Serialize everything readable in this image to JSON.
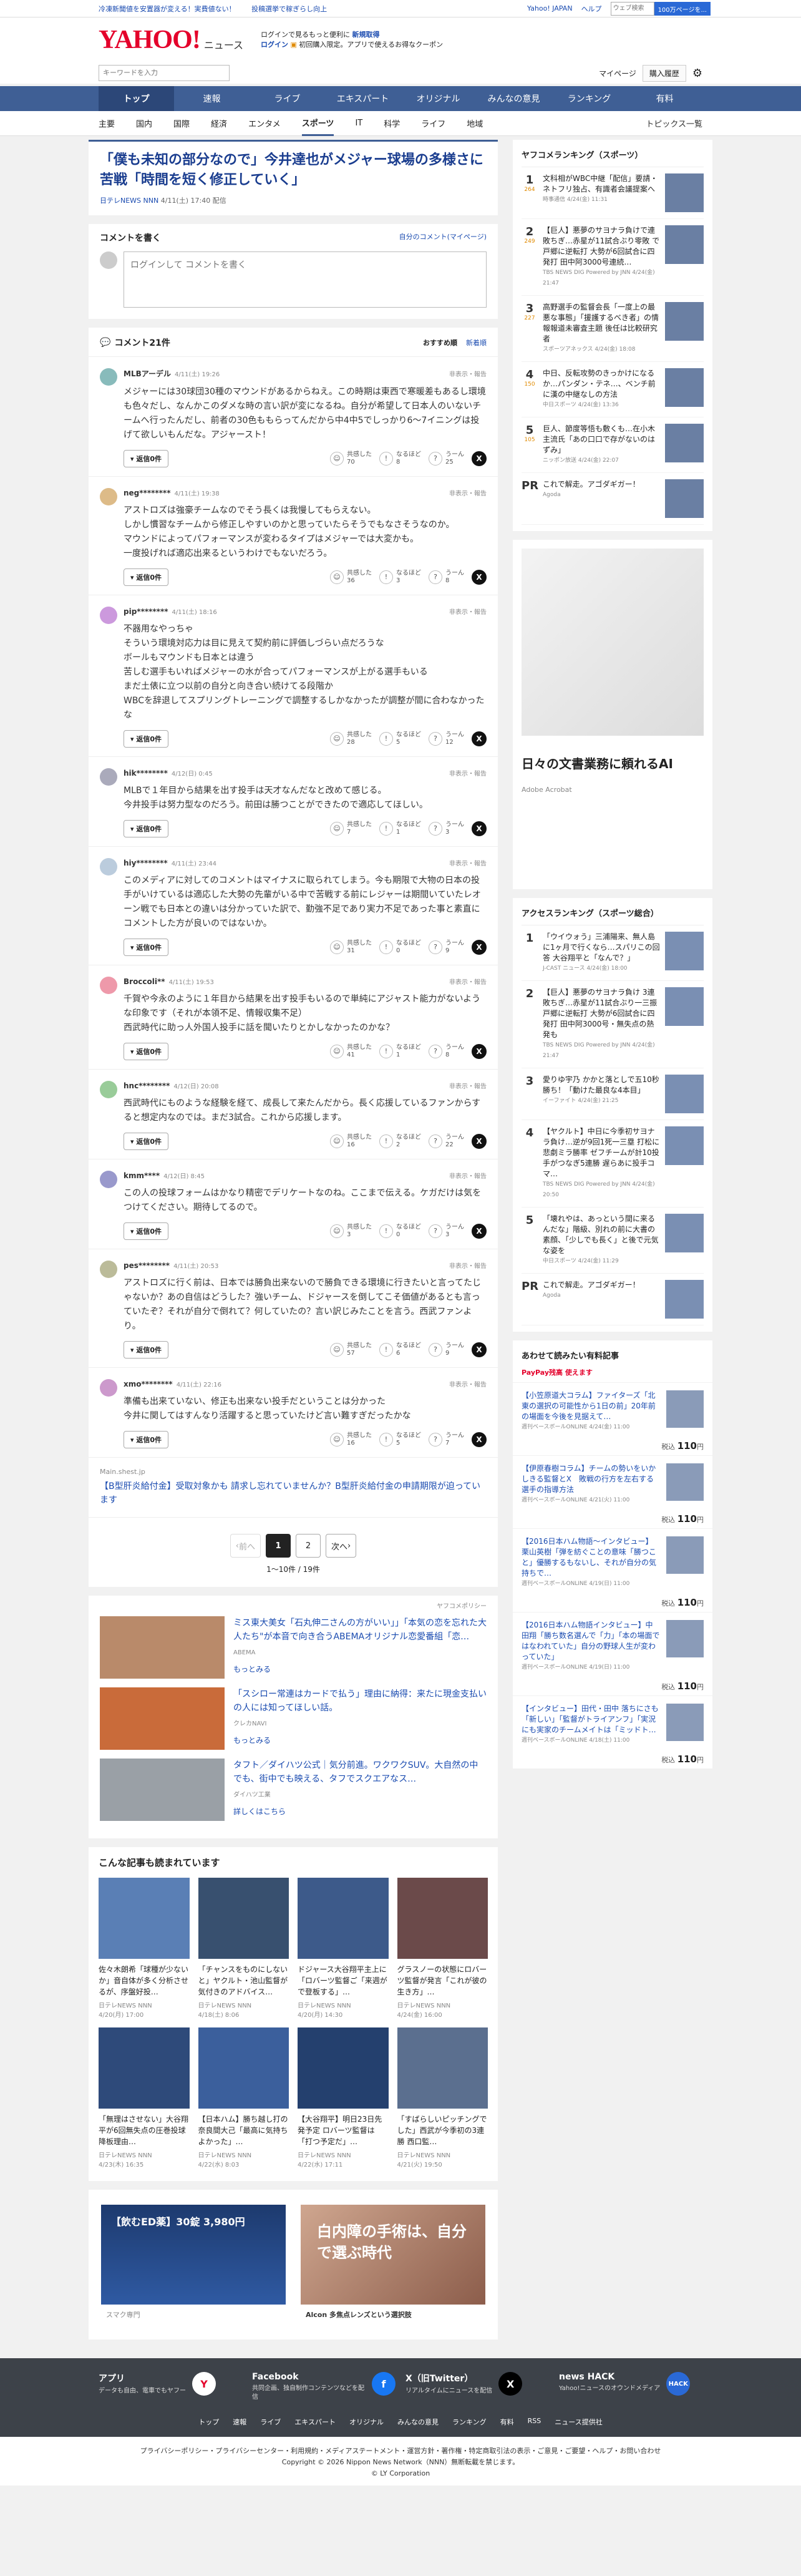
{
  "topbar": {
    "links": [
      "冷凍新聞値を安置器が変える！実費値ない！",
      "投稿選挙で稼ぎらし向上"
    ],
    "right": [
      "Yahoo! JAPAN",
      "ヘルプ"
    ],
    "search_placeholder": "ウェブ検索",
    "search_btn": "100万ページを..."
  },
  "header": {
    "logo": "YAHOO!",
    "logo_sub": "ニュース",
    "promo1": "ログインで見るもっと便利に",
    "promo1b": "新規取得",
    "promo2": "ログイン",
    "promo2b": "初回購入限定。アプリで使えるお得なクーポン"
  },
  "search": {
    "placeholder": "キーワードを入力",
    "mypage": "マイページ",
    "purchase": "購入履歴"
  },
  "mainnav": [
    "トップ",
    "速報",
    "ライブ",
    "エキスパート",
    "オリジナル",
    "みんなの意見",
    "ランキング",
    "有料"
  ],
  "subnav": [
    "主要",
    "国内",
    "国際",
    "経済",
    "エンタメ",
    "スポーツ",
    "IT",
    "科学",
    "ライフ",
    "地域"
  ],
  "subnav_right": "トピックス一覧",
  "article": {
    "title": "「僕も未知の部分なので」今井達也がメジャー球場の多様さに苦戦「時間を短く修正していく」",
    "source": "日テレNEWS NNN",
    "date": "4/11(土) 17:40 配信"
  },
  "write": {
    "title": "コメントを書く",
    "link": "自分のコメント(マイページ)",
    "placeholder": "ログインして コメントを書く"
  },
  "clist": {
    "title": "コメント21件",
    "sort1": "おすすめ順",
    "sort2": "新着順"
  },
  "labels": {
    "report": "非表示・報告",
    "reply": "返信0件",
    "r1": "共感した",
    "r2": "なるほど",
    "r3": "うーん"
  },
  "comments": [
    {
      "user": "MLBアーデル",
      "date": "4/11(土) 19:26",
      "text": "メジャーには30球団30種のマウンドがあるからねえ。この時期は東西で寒暖差もあるし環境も色々だし、なんかこのダメな時の言い訳が変になるね。自分が希望して日本人のいないチームへ行ったんだし、前者の30色ももらってんだから中4中5でしっかり6〜7イニングは投げて欲しいもんだな。アジャースト！",
      "n": [
        70,
        8,
        25
      ]
    },
    {
      "user": "neg********",
      "date": "4/11(土) 19:38",
      "text": "アストロズは強豪チームなのでそう長くは我慢してもらえない。\nしかし慣習なチームから修正しやすいのかと思っていたらそうでもなさそうなのか。\nマウンドによってパフォーマンスが変わるタイプはメジャーでは大変かも。\n一度投げれば適応出来るというわけでもないだろう。",
      "n": [
        36,
        3,
        8
      ]
    },
    {
      "user": "pip********",
      "date": "4/11(土) 18:16",
      "text": "不器用なやっちゃ\nそういう環境対応力は目に見えて契約前に評価しづらい点だろうな\nボールもマウンドも日本とは違う\n苦しむ選手もいればメジャーの水が合ってパフォーマンスが上がる選手もいる\nまだ土俵に立つ以前の自分と向き合い続けてる段階か\nWBCを辞退してスプリングトレーニングで調整するしかなかったが調整が間に合わなかったな",
      "n": [
        28,
        5,
        12
      ]
    },
    {
      "user": "hik********",
      "date": "4/12(日) 0:45",
      "text": "MLBで１年目から結果を出す投手は天才なんだなと改めて感じる。\n今井投手は努力型なのだろう。前田は勝つことができたので適応してほしい。",
      "n": [
        7,
        1,
        3
      ]
    },
    {
      "user": "hiy********",
      "date": "4/11(土) 23:44",
      "text": "このメディアに対してのコメントはマイナスに取られてしまう。今も期限で大物の日本の投手がいけているは適応した大勢の先輩がいる中で苦戦する前にレジャーは期間いていたレオーン戦でも日本との違いは分かっていた訳で、勤強不足であり実力不足であった事と素直にコメントした方が良いのではないか。",
      "n": [
        31,
        0,
        9
      ]
    },
    {
      "user": "Broccoli**",
      "date": "4/11(土) 19:53",
      "text": "千賀や今永のように１年目から結果を出す投手もいるので単純にアジャスト能力がないような印象です（それが本領不足、情報収集不足）\n西武時代に助っ人外国人投手に話を聞いたりとかしなかったのかな？",
      "n": [
        41,
        1,
        8
      ]
    },
    {
      "user": "hnc********",
      "date": "4/12(日) 20:08",
      "text": "西武時代にものような経験を経て、成長して来たんだから。長く応援しているファンからすると想定内なのでは。まだ3試合。これから応援します。",
      "n": [
        16,
        2,
        22
      ]
    },
    {
      "user": "kmm****",
      "date": "4/12(日) 8:45",
      "text": "この人の投球フォームはかなり精密でデリケートなのね。ここまで伝える。ケガだけは気をつけてください。期待してるので。",
      "n": [
        3,
        0,
        3
      ]
    },
    {
      "user": "pes********",
      "date": "4/11(土) 20:53",
      "text": "アストロズに行く前は、日本では勝負出来ないので勝負できる環境に行きたいと言ってたじゃないか？あの自信はどうした？強いチーム、ドジャースを倒してこそ価値があるとも言っていたぞ？それが自分で倒れて？何していたの？言い訳じみたことを言う。西武ファンより。",
      "n": [
        57,
        6,
        9
      ]
    },
    {
      "user": "xmo********",
      "date": "4/11(土) 22:16",
      "text": "準備も出来ていない、修正も出来ない投手だということは分かった\n今井に関してはすんなり活躍すると思っていたけど言い難すぎだったかな",
      "n": [
        16,
        5,
        7
      ]
    }
  ],
  "ad_comment": {
    "source": "Main.shest.jp",
    "text": "【B型肝炎給付金】受取対象かも 請求し忘れていませんか？B型肝炎給付金の申請期限が迫っています"
  },
  "pager": {
    "prev": "前へ",
    "next": "次へ",
    "p1": "1",
    "p2": "2",
    "count": "1〜10件 / 19件"
  },
  "sponsor": {
    "policy": "ヤフコメポリシー",
    "items": [
      {
        "t": "ミス東大美女「石丸伸二さんの方がいい」」「本気の恋を忘れた大人たち\"が本音で向き合うABEMAオリジナル恋愛番組「恋…",
        "s": "ABEMA",
        "m": "もっとみる"
      },
      {
        "t": "「スシロー常連はカードで払う」理由に納得：来たに現金支払いの人には知ってほしい話。",
        "s": "クレカNAVI",
        "m": "もっとみる"
      },
      {
        "t": "タフト／ダイハツ公式｜気分前進。ワクワクSUV。大自然の中でも、街中でも映える、タフでスクエアなス…",
        "s": "ダイハツ工業",
        "m": "詳しくはこちら"
      }
    ]
  },
  "related": {
    "title": "こんな記事も読まれています",
    "items": [
      {
        "t": "佐々木朗希「球種が少ないか」音自体が多く分析させるが、序盤好投…",
        "s": "日テレNEWS NNN",
        "d": "4/20(月) 17:00"
      },
      {
        "t": "「チャンスをものにしないと」ヤクルト・池山監督が気付きのアドバイス…",
        "s": "日テレNEWS NNN",
        "d": "4/18(土) 8:06"
      },
      {
        "t": "ドジャース大谷翔平主上に「ロバーツ監督ご「来週がで登板する」…",
        "s": "日テレNEWS NNN",
        "d": "4/20(月) 14:30"
      },
      {
        "t": "グラスノーの状態にロバーツ監督が発言「これが彼の生き方」…",
        "s": "日テレNEWS NNN",
        "d": "4/24(金) 16:00"
      },
      {
        "t": "「無理はさせない」大谷翔平が6回無失点の圧巻投球 降板理由…",
        "s": "日テレNEWS NNN",
        "d": "4/23(木) 16:35"
      },
      {
        "t": "【日本ハム】勝ち越し打の奈良間大己「最高に気持ちよかった」…",
        "s": "日テレNEWS NNN",
        "d": "4/22(水) 8:03"
      },
      {
        "t": "【大谷翔平】明日23日先発予定 ロバーツ監督は「打つ予定だ」…",
        "s": "日テレNEWS NNN",
        "d": "4/22(水) 17:11"
      },
      {
        "t": "「すばらしいピッチングでした」西武が今季初の3連勝 西口監…",
        "s": "日テレNEWS NNN",
        "d": "4/21(火) 19:50"
      }
    ]
  },
  "bottom_ads": [
    {
      "t": "【飲むED薬】30錠 3,980円",
      "s": "スマク専門"
    },
    {
      "t": "白内障の手術は、自分で選ぶ時代",
      "s": "Alcon 多焦点レンズという選択肢"
    }
  ],
  "ranking": {
    "title": "ヤフコメランキング（スポーツ）",
    "items": [
      {
        "n": "1",
        "c": "264",
        "t": "文科相がWBC中継「配信」要請・ネトフリ独占、有識者会議提案へ",
        "s": "時事通信 4/24(金) 11:31"
      },
      {
        "n": "2",
        "c": "249",
        "t": "【巨人】悪夢のサヨナラ負けで連敗ちぎ…赤星が11試合ぶり零敗 で戸郷に逆転打 大勢が6回試合に四発打 田中阿3000号連続…",
        "s": "TBS NEWS DIG Powered by JNN 4/24(金) 21:47"
      },
      {
        "n": "3",
        "c": "227",
        "t": "高野選手の監督会長「一度上の最悪な事態」「援護するべき者」の情報報道未審査主題 後任は比較研究者",
        "s": "スポーツアネックス 4/24(金) 18:08"
      },
      {
        "n": "4",
        "c": "150",
        "t": "中日、反転攻勢のきっかけになるか…パンダン・テネ…、ベンチ前に漢の中継なしの方法",
        "s": "中日スポーツ 4/24(金) 13:36"
      },
      {
        "n": "5",
        "c": "105",
        "t": "巨人、節度等悟も敷くも…在小木主流氏「あの口口で存がないのはずみ」",
        "s": "ニッポン放送 4/24(金) 22:07"
      },
      {
        "n": "PR",
        "c": "",
        "t": "これで解走。アゴダギガー！",
        "s": "Agoda"
      }
    ]
  },
  "sidead": {
    "t": "日々の文書業務に頼れるAI",
    "s": "Adobe Acrobat"
  },
  "access": {
    "title": "アクセスランキング（スポーツ総合）",
    "items": [
      {
        "n": "1",
        "t": "「ウイウォう」三浦陽来、無人島に1ヶ月で行くなら…スパリこの回答 大谷翔平と「なんで？」",
        "s": "J-CAST ニュース 4/24(金) 18:00"
      },
      {
        "n": "2",
        "t": "【巨人】悪夢のサヨナラ負け 3連敗ちぎ…赤星が11試合ぶり一三振 戸郷に逆転打 大勢が6回試合に四発打 田中阿3000号・無失点の熱発も",
        "s": "TBS NEWS DIG Powered by JNN 4/24(金) 21:47"
      },
      {
        "n": "3",
        "t": "愛りゆ宇乃 かかと落としで五10秒勝ち！「動けた最良な4本目」",
        "s": "イーファイト 4/24(金) 21:25"
      },
      {
        "n": "4",
        "t": "【ヤクルト】中日に今季初サヨナラ負け…逆が9回1死一三塁 打松に悲劇ミラ勝率 ゼフチームが計10投手がつなぎ5連勝 遅らあに投手コマ…",
        "s": "TBS NEWS DIG Powered by JNN 4/24(金) 20:50"
      },
      {
        "n": "5",
        "t": "「壊れやは、あっという間に来るんだな」階級、別れの前に大書の素顔、「少しでも長く」と後で元気な姿を",
        "s": "中日スポーツ 4/24(金) 11:29"
      },
      {
        "n": "PR",
        "t": "これで解走。アゴダギガー！",
        "s": "Agoda"
      }
    ]
  },
  "paid": {
    "title": "あわせて読みたい有料記事",
    "logo": "PayPay残高 使えます",
    "items": [
      {
        "t": "【小笠原道大コラム】ファイターズ「北東の選択の可能性から1日の前」20年前の場面を今後を見据えて…",
        "s": "週刊ベースボールONLINE 4/24(金) 11:00",
        "p": "110"
      },
      {
        "t": "【伊原春樹コラム】チームの勢いをいかしきる監督とX　敗戦の行方を左右する選手の指導方法",
        "s": "週刊ベースボールONLINE 4/21(火) 11:00",
        "p": "110"
      },
      {
        "t": "【2016日本ハム物語〜インタビュー】栗山英樹「弾を紡ぐことの意味「勝つこと」優勝するもないし、それが自分の気持ちで…",
        "s": "週刊ベースボールONLINE 4/19(日) 11:00",
        "p": "110"
      },
      {
        "t": "【2016日本ハム物語インタビュー】中田翔「勝ち数名選んで「力」「本の場面ではなわれていた」自分の野球人生が変わっていた」",
        "s": "週刊ベースボールONLINE 4/19(日) 11:00",
        "p": "110"
      },
      {
        "t": "【インタビュー】田代・田中 落ちにさも「新しい」「監督がトライアンフ」「実況にも実家のチームメイトは「ミッドト…",
        "s": "週刊ベースボールONLINE 4/18(土) 11:00",
        "p": "110"
      }
    ],
    "currency": "税込"
  },
  "footer": {
    "apps": [
      {
        "t": "アプリ",
        "s": "データも自由、電車でもヤフー"
      },
      {
        "t": "Facebook",
        "s": "共同企画、独自制作コンテンツなどを配信"
      },
      {
        "t": "X（旧Twitter）",
        "s": "リアルタイムにニュースを配信"
      },
      {
        "t": "news HACK",
        "s": "Yahoo!ニュースのオウンドメディア"
      }
    ],
    "nav": [
      "トップ",
      "速報",
      "ライブ",
      "エキスパート",
      "オリジナル",
      "みんなの意見",
      "ランキング",
      "有料",
      "RSS",
      "ニュース提供社"
    ],
    "links": "プライバシーポリシー・プライバシーセンター・利用規約・メディアステートメント・運営方針・著作権・特定商取引法の表示・ご意見・ご要望・ヘルプ・お問い合わせ",
    "copy1": "Copyright © 2026 Nippon News Network（NNN）無断転載を禁じます。",
    "copy2": "© LY Corporation"
  }
}
